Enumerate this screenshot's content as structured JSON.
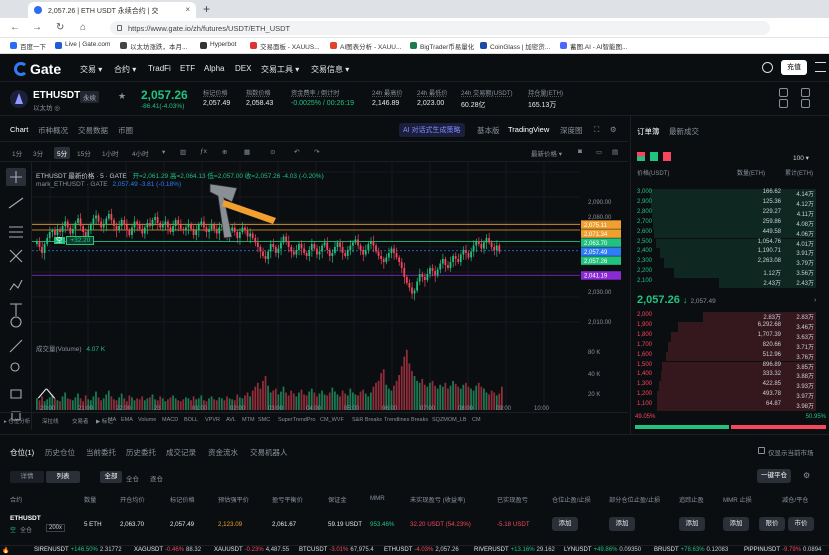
{
  "browser": {
    "tab_title": "2,057.26 | ETH USDT 永续合约 | 交",
    "url": "https://www.gate.io/zh/futures/USDT/ETH_USDT",
    "bookmarks": [
      "百度一下",
      "Live | Gate.com",
      "以太坊涨跌，本月...",
      "Hyperbot",
      "交易面板 - XAUUS...",
      "AI图表分析 - XAUU...",
      "BigTrader币易量化",
      "CoinGlass | 加密货...",
      "蓄图.AI - AI智能图..."
    ]
  },
  "header": {
    "logo": "Gate",
    "nav": [
      "交易 ▾",
      "合约 ▾",
      "TradFi",
      "ETF",
      "Alpha",
      "DEX",
      "交易工具 ▾",
      "交易信息 ▾"
    ],
    "deposit_label": "充值"
  },
  "ticker": {
    "symbol": "ETHUSDT",
    "type": "永续",
    "subname": "以太坊 ◎",
    "last_price": "2,057.26",
    "change": "-86.41(-4.03%)",
    "stats": [
      {
        "label": "标记价格",
        "value": "2,057.49"
      },
      {
        "label": "指数价格",
        "value": "2,058.43"
      },
      {
        "label": "资金费率 / 倒计时",
        "value": "-0.0025% / 00:26:19"
      },
      {
        "label": "24h 最高价",
        "value": "2,146.89"
      },
      {
        "label": "24h 最低价",
        "value": "2,023.00"
      },
      {
        "label": "24h 交易额(USDT)",
        "value": "60.28亿"
      },
      {
        "label": "持仓量(ETH)",
        "value": "165.13万"
      }
    ]
  },
  "chart_tabs": {
    "left": [
      "Chart",
      "币种概况",
      "交易数据",
      "币圈"
    ],
    "ai": "AI 对话式生成策略",
    "right": [
      "基本版",
      "TradingView",
      "深度图"
    ]
  },
  "toolbar": {
    "intervals": [
      "1分",
      "3分",
      "5分",
      "15分",
      "1小时",
      "4小时",
      "▾"
    ],
    "latest_price": "最新价格 ▾"
  },
  "chart_legend": {
    "title": "ETHUSDT 最新价格 · 5 · GATE",
    "ohlc": "开=2,061.29  高=2,064.13  低=2,057.00  收=2,057.26  -4.03 (-0.20%)",
    "mark": "mark_ETHUSDT · GATE",
    "mark_vals": "2,057.49  -3.81 (-0.18%)",
    "volume": "成交量(Volume)",
    "volume_val": "4.07 K",
    "position_qty": "+32.20",
    "position_tag": "空"
  },
  "chart_data": {
    "type": "candlestick",
    "ylim": [
      2010,
      2110
    ],
    "y_ticks": [
      "2,090.00",
      "2,080.00",
      "2,050.00",
      "2,030.00",
      "2,010.00"
    ],
    "x_ticks": [
      "20:00",
      "21:00",
      "22:00",
      "23",
      "01:00",
      "02:00",
      "03:00",
      "04:00",
      "05:00",
      "06:00",
      "07:00",
      "08:00",
      "09:00",
      "10:00"
    ],
    "price_labels": [
      {
        "value": "2,075.11",
        "color": "#f0a030"
      },
      {
        "value": "2,071.34",
        "color": "#f0a030"
      },
      {
        "value": "2,063.70",
        "color": "#20c27e"
      },
      {
        "value": "2,057.49",
        "color": "#2e7cf6"
      },
      {
        "value": "2,057.26",
        "color": "#20c27e"
      },
      {
        "value": "2,041.19",
        "color": "#8b2bd6"
      }
    ],
    "volume_ticks": [
      "80 K",
      "40 K",
      "20 K"
    ],
    "closes": [
      2064,
      2060,
      2056,
      2062,
      2066,
      2070,
      2071,
      2068,
      2072,
      2070,
      2074,
      2077,
      2073,
      2069,
      2072,
      2076,
      2079,
      2074,
      2070,
      2067,
      2071,
      2075,
      2079,
      2081,
      2077,
      2073,
      2075,
      2079,
      2082,
      2078,
      2074,
      2071,
      2074,
      2078,
      2075,
      2071,
      2068,
      2073,
      2077,
      2075,
      2072,
      2069,
      2073,
      2076,
      2074,
      2078,
      2080,
      2076,
      2073,
      2075,
      2077,
      2073,
      2070,
      2074,
      2078,
      2075,
      2072,
      2071,
      2073,
      2075,
      2072,
      2068,
      2071,
      2075,
      2077,
      2073,
      2070,
      2072,
      2075,
      2072,
      2069,
      2073,
      2075,
      2071,
      2068,
      2071,
      2073,
      2070,
      2066,
      2070,
      2073,
      2071,
      2067,
      2069,
      2066,
      2063,
      2060,
      2057,
      2054,
      2052,
      2057,
      2062,
      2060,
      2056,
      2059,
      2063,
      2067,
      2064,
      2060,
      2057,
      2055,
      2058,
      2062,
      2059,
      2056,
      2054,
      2058,
      2062,
      2059,
      2055,
      2057,
      2061,
      2063,
      2058,
      2054,
      2056,
      2060,
      2063,
      2060,
      2056,
      2054,
      2058,
      2061,
      2063,
      2065,
      2061,
      2058,
      2055,
      2058,
      2062,
      2064,
      2061,
      2057,
      2054,
      2052,
      2050,
      2053,
      2056,
      2059,
      2056,
      2053,
      2050,
      2046,
      2040,
      2036,
      2033,
      2029,
      2031,
      2037,
      2042,
      2040,
      2038,
      2042,
      2046,
      2044,
      2041,
      2045,
      2049,
      2052,
      2048,
      2046,
      2050,
      2054,
      2052,
      2050,
      2055,
      2058,
      2056,
      2053,
      2057,
      2061,
      2064,
      2062,
      2059,
      2063,
      2066,
      2063,
      2060,
      2058,
      2061,
      2057
    ],
    "volumes": [
      12,
      10,
      14,
      9,
      11,
      13,
      16,
      12,
      10,
      9,
      14,
      18,
      12,
      11,
      10,
      13,
      17,
      12,
      9,
      15,
      11,
      10,
      14,
      19,
      13,
      10,
      12,
      16,
      20,
      14,
      11,
      10,
      13,
      17,
      12,
      9,
      15,
      13,
      10,
      12,
      11,
      14,
      10,
      12,
      13,
      16,
      11,
      10,
      14,
      12,
      9,
      11,
      13,
      15,
      12,
      10,
      9,
      11,
      13,
      12,
      10,
      14,
      11,
      12,
      15,
      10,
      9,
      12,
      14,
      11,
      10,
      13,
      12,
      10,
      14,
      12,
      11,
      10,
      16,
      13,
      12,
      15,
      18,
      14,
      20,
      24,
      28,
      22,
      30,
      35,
      25,
      18,
      20,
      22,
      16,
      19,
      24,
      18,
      15,
      20,
      17,
      14,
      18,
      21,
      16,
      15,
      19,
      22,
      18,
      14,
      17,
      20,
      16,
      15,
      18,
      23,
      19,
      16,
      14,
      20,
      17,
      15,
      22,
      18,
      16,
      15,
      19,
      21,
      17,
      14,
      18,
      24,
      28,
      30,
      38,
      42,
      26,
      22,
      20,
      25,
      30,
      36,
      45,
      55,
      62,
      48,
      40,
      35,
      30,
      28,
      32,
      26,
      24,
      28,
      30,
      25,
      22,
      26,
      24,
      28,
      22,
      25,
      30,
      27,
      24,
      22,
      26,
      28,
      24,
      22,
      20,
      25,
      28,
      24,
      22,
      18,
      16,
      20,
      18,
      15,
      17,
      24
    ]
  },
  "orderbook": {
    "tabs": [
      "订单簿",
      "最新成交"
    ],
    "precision": "100 ▾",
    "headers": [
      "价格(USDT)",
      "数量(ETH)",
      "累计(ETH)"
    ],
    "asks": [
      {
        "price": "3,000",
        "qty": "166.62",
        "total": "4.14万"
      },
      {
        "price": "2,900",
        "qty": "125.36",
        "total": "4.12万"
      },
      {
        "price": "2,800",
        "qty": "229.27",
        "total": "4.11万"
      },
      {
        "price": "2,700",
        "qty": "259.86",
        "total": "4.08万"
      },
      {
        "price": "2,600",
        "qty": "449.58",
        "total": "4.06万"
      },
      {
        "price": "2,500",
        "qty": "1,054.76",
        "total": "4.01万"
      },
      {
        "price": "2,400",
        "qty": "1,190.71",
        "total": "3.91万"
      },
      {
        "price": "2,300",
        "qty": "2,263.08",
        "total": "3.79万"
      },
      {
        "price": "2,200",
        "qty": "1.12万",
        "total": "3.56万"
      },
      {
        "price": "2,100",
        "qty": "2.43万",
        "total": "2.43万"
      }
    ],
    "mid_price": "2,057.26",
    "mid_mark": "2,057.49",
    "bids": [
      {
        "price": "2,000",
        "qty": "2.83万",
        "total": "2.83万"
      },
      {
        "price": "1,900",
        "qty": "6,292.68",
        "total": "3.46万"
      },
      {
        "price": "1,800",
        "qty": "1,707.39",
        "total": "3.63万"
      },
      {
        "price": "1,700",
        "qty": "820.66",
        "total": "3.71万"
      },
      {
        "price": "1,600",
        "qty": "512.96",
        "total": "3.76万"
      },
      {
        "price": "1,500",
        "qty": "896.89",
        "total": "3.85万"
      },
      {
        "price": "1,400",
        "qty": "333.32",
        "total": "3.88万"
      },
      {
        "price": "1,300",
        "qty": "422.85",
        "total": "3.93万"
      },
      {
        "price": "1,200",
        "qty": "493.78",
        "total": "3.97万"
      },
      {
        "price": "1,100",
        "qty": "64.87",
        "total": "3.98万"
      }
    ],
    "buy_ratio": "49.05%",
    "sell_ratio": "50.95%",
    "buy_fraction": 0.49
  },
  "positions": {
    "tabs": [
      "仓位(1)",
      "历史仓位",
      "当前委托",
      "历史委托",
      "成交记录",
      "资金流水",
      "交易机器人"
    ],
    "only_current": "仅显示当前市场",
    "view_detail": "详情",
    "view_list": "列表",
    "filters": [
      "全部",
      "全仓",
      "逐仓"
    ],
    "close_all": "一键平仓",
    "headers": [
      "合约",
      "数量",
      "开仓均价",
      "标记价格",
      "预估强平价",
      "盈亏平衡价",
      "保证金",
      "MMR",
      "未实现盈亏 (收益率)",
      "已实现盈亏",
      "仓位止盈/止损",
      "部分仓位止盈/止损",
      "追踪止盈",
      "MMR 止损",
      "减仓/平仓"
    ],
    "row": {
      "contract": "ETHUSDT",
      "side": "空",
      "margin_mode": "全仓",
      "leverage": "200x",
      "qty": "5 ETH",
      "entry": "2,063.70",
      "mark": "2,057.49",
      "liq": "2,123.09",
      "breakeven": "2,061.67",
      "margin": "59.19 USDT",
      "mmr": "953.46%",
      "upnl": "32.20 USDT (54.23%)",
      "rpnl": "-5.18 USDT",
      "add": "添加",
      "limit": "限价",
      "market": "市价"
    }
  },
  "marquee": [
    {
      "sym": "SIRENUSDT",
      "chg": "+146.50%",
      "price": "2.31772",
      "up": true
    },
    {
      "sym": "XAGUSDT",
      "chg": "-0.46%",
      "price": "88.32",
      "up": false
    },
    {
      "sym": "XAUUSDT",
      "chg": "-0.23%",
      "price": "4,487.55",
      "up": false
    },
    {
      "sym": "BTCUSDT",
      "chg": "-3.01%",
      "price": "67,975.4",
      "up": false
    },
    {
      "sym": "ETHUSDT",
      "chg": "-4.03%",
      "price": "2,057.26",
      "up": false
    },
    {
      "sym": "RIVERUSDT",
      "chg": "+13.16%",
      "price": "29.162",
      "up": true
    },
    {
      "sym": "LYNUSDT",
      "chg": "+49.86%",
      "price": "0.09350",
      "up": true
    },
    {
      "sym": "BRUSDT",
      "chg": "+78.63%",
      "price": "0.12083",
      "up": true
    },
    {
      "sym": "PIPPINUSDT",
      "chg": "-9.79%",
      "price": "0.0894",
      "up": false
    }
  ],
  "colors": {
    "up": "#20c27e",
    "down": "#f6465d",
    "accent": "#2e7cf6",
    "bg": "#0b0e11"
  }
}
